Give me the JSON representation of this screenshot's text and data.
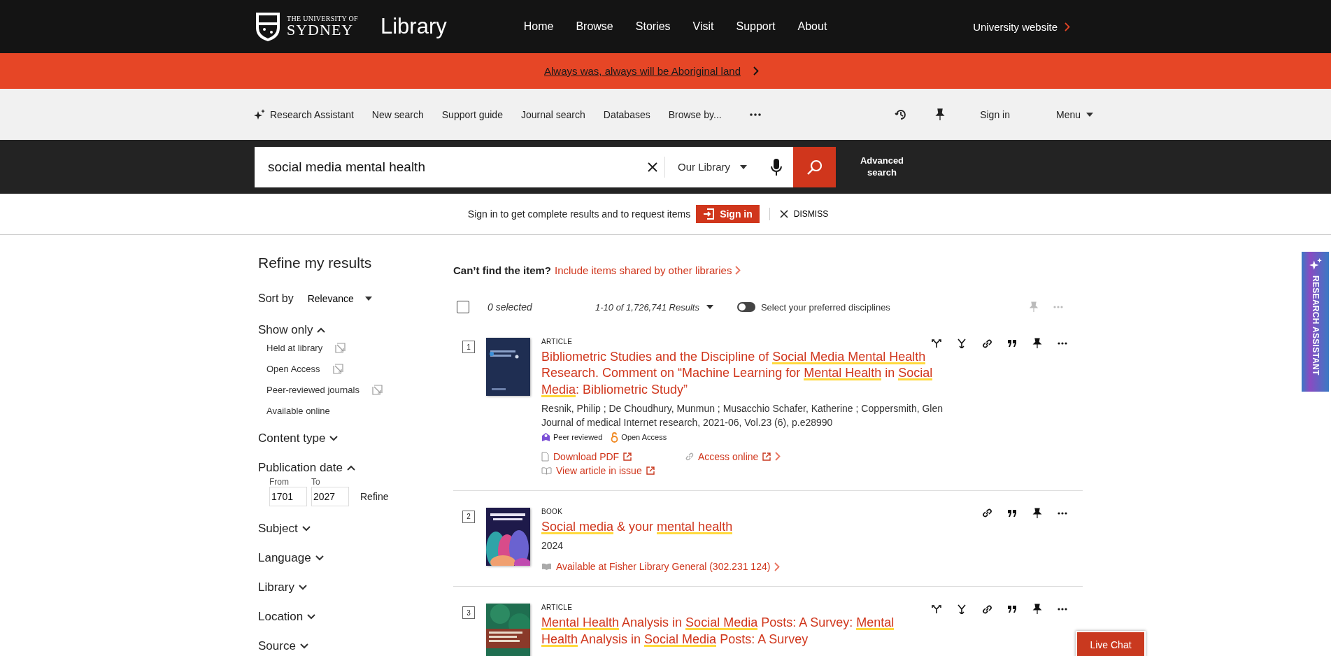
{
  "header": {
    "logo_top": "THE UNIVERSITY OF",
    "logo_bottom": "SYDNEY",
    "site_title": "Library",
    "nav": [
      "Home",
      "Browse",
      "Stories",
      "Visit",
      "Support",
      "About"
    ],
    "university_link": "University website"
  },
  "banner": {
    "text": "Always was, always will be Aboriginal land"
  },
  "toolbar": {
    "items": [
      "Research Assistant",
      "New search",
      "Support guide",
      "Journal search",
      "Databases",
      "Browse by..."
    ],
    "sign_in": "Sign in",
    "menu": "Menu"
  },
  "search": {
    "value": "social media mental health",
    "scope": "Our Library",
    "advanced": "Advanced search"
  },
  "signin_prompt": {
    "text": "Sign in to get complete results and to request items",
    "button": "Sign in",
    "dismiss": "DISMISS"
  },
  "refine": {
    "title": "Refine my results",
    "sort_label": "Sort by",
    "sort_value": "Relevance",
    "sections": [
      {
        "kind": "options",
        "label": "Show only",
        "expanded": true,
        "options": [
          {
            "label": "Held at library",
            "excludable": true
          },
          {
            "label": "Open Access",
            "excludable": true
          },
          {
            "label": "Peer-reviewed journals",
            "excludable": true
          },
          {
            "label": "Available online",
            "excludable": false
          }
        ]
      },
      {
        "kind": "plain",
        "label": "Content type",
        "expanded": false
      },
      {
        "kind": "date",
        "label": "Publication date",
        "expanded": true,
        "from_label": "From",
        "from": "1701",
        "to_label": "To",
        "to": "2027",
        "button": "Refine"
      },
      {
        "kind": "plain",
        "label": "Subject",
        "expanded": false
      },
      {
        "kind": "plain",
        "label": "Language",
        "expanded": false
      },
      {
        "kind": "plain",
        "label": "Library",
        "expanded": false
      },
      {
        "kind": "plain",
        "label": "Location",
        "expanded": false
      },
      {
        "kind": "plain",
        "label": "Source",
        "expanded": false
      }
    ]
  },
  "results_header": {
    "prompt": "Can’t find the item?",
    "link": "Include items shared by other libraries",
    "select_all_checked": false,
    "selected": "0 selected",
    "count": "1-10 of 1,726,741 Results",
    "disciplines_on": false,
    "disciplines_label": "Select your preferred disciplines"
  },
  "results": [
    {
      "number": "1",
      "type": "ARTICLE",
      "citation_trail": true,
      "cover": {
        "kind": "picture"
      },
      "title": [
        {
          "text": "Bibliometric Studies and the Discipline of ",
          "highlighted": false
        },
        {
          "text": "Social Media Mental Health",
          "highlighted": true
        },
        {
          "text": " Research. Comment on “Machine Learning for ",
          "highlighted": false
        },
        {
          "text": "Mental Health",
          "highlighted": true
        },
        {
          "text": " in ",
          "highlighted": false
        },
        {
          "text": "Social Media",
          "highlighted": true
        },
        {
          "text": ": Bibliometric Study”",
          "highlighted": false
        }
      ],
      "details": [
        "Resnik, Philip ; De Choudhury, Munmun ; Musacchio Schafer, Katherine ; Coppersmith, Glen",
        "Journal of medical Internet research, 2021-06, Vol.23 (6), p.e28990"
      ],
      "badges": [
        {
          "kind": "peer",
          "label": "Peer reviewed"
        },
        {
          "kind": "open",
          "label": "Open Access"
        }
      ],
      "links": [
        {
          "kind": "pdf",
          "label": "Download PDF"
        },
        {
          "kind": "online",
          "label": "Access online"
        },
        {
          "kind": "issue",
          "label": "View article in issue"
        }
      ]
    },
    {
      "number": "2",
      "type": "BOOK",
      "citation_trail": false,
      "cover": {
        "kind": "picture"
      },
      "title": [
        {
          "text": "Social media",
          "highlighted": true
        },
        {
          "text": " & your ",
          "highlighted": false
        },
        {
          "text": "mental health",
          "highlighted": true
        }
      ],
      "details": [
        "2024"
      ],
      "links": [
        {
          "kind": "availability",
          "label": "Available at Fisher Library  General (302.231 124)"
        }
      ]
    },
    {
      "number": "3",
      "type": "ARTICLE",
      "citation_trail": true,
      "cover": {
        "kind": "picture"
      },
      "title": [
        {
          "text": "Mental Health",
          "highlighted": true
        },
        {
          "text": " Analysis in ",
          "highlighted": false
        },
        {
          "text": "Social Media",
          "highlighted": true
        },
        {
          "text": " Posts: A Survey: ",
          "highlighted": false
        },
        {
          "text": "Mental Health",
          "highlighted": true
        },
        {
          "text": " Analysis in ",
          "highlighted": false
        },
        {
          "text": "Social Media",
          "highlighted": true
        },
        {
          "text": " Posts: A Survey",
          "highlighted": false
        }
      ]
    }
  ],
  "side_tab": {
    "label": "RESEARCH ASSISTANT"
  },
  "live_chat": {
    "label": "Live Chat"
  }
}
